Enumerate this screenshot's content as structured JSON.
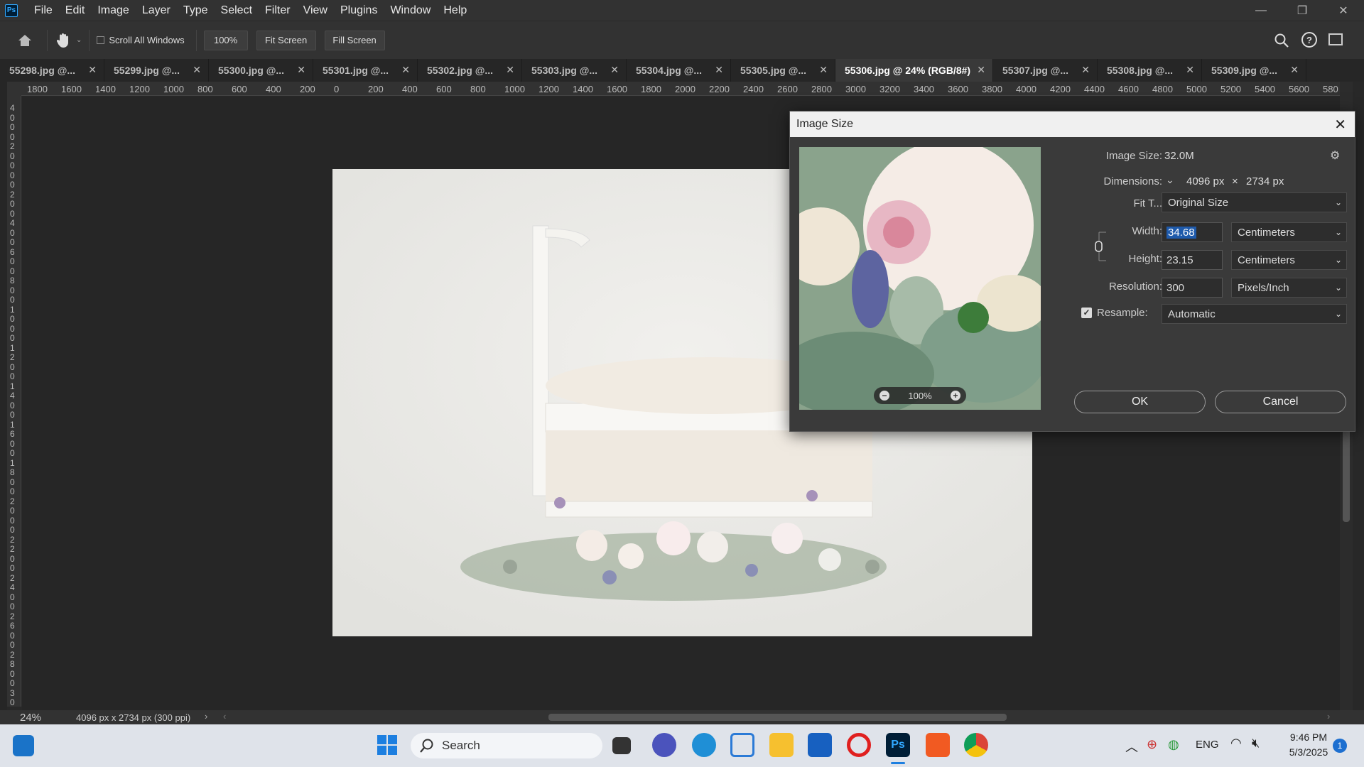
{
  "app": {
    "logo": "Ps"
  },
  "menu": [
    "File",
    "Edit",
    "Image",
    "Layer",
    "Type",
    "Select",
    "Filter",
    "View",
    "Plugins",
    "Window",
    "Help"
  ],
  "options": {
    "scroll_all_windows": "Scroll All Windows",
    "zoom": "100%",
    "fit_screen": "Fit Screen",
    "fill_screen": "Fill Screen"
  },
  "tabs": [
    {
      "label": "55298.jpg @..."
    },
    {
      "label": "55299.jpg @..."
    },
    {
      "label": "55300.jpg @..."
    },
    {
      "label": "55301.jpg @..."
    },
    {
      "label": "55302.jpg @..."
    },
    {
      "label": "55303.jpg @..."
    },
    {
      "label": "55304.jpg @..."
    },
    {
      "label": "55305.jpg @..."
    },
    {
      "label": "55306.jpg @ 24% (RGB/8#)"
    },
    {
      "label": "55307.jpg @..."
    },
    {
      "label": "55308.jpg @..."
    },
    {
      "label": "55309.jpg @..."
    }
  ],
  "ruler_h": [
    "1800",
    "1600",
    "1400",
    "1200",
    "1000",
    "800",
    "600",
    "400",
    "200",
    "0",
    "200",
    "400",
    "600",
    "800",
    "1000",
    "1200",
    "1400",
    "1600",
    "1800",
    "2000",
    "2200",
    "2400",
    "2600",
    "2800",
    "3000",
    "3200",
    "3400",
    "3600",
    "3800",
    "4000",
    "4200",
    "4400",
    "4600",
    "4800",
    "5000",
    "5200",
    "5400",
    "5600",
    "580"
  ],
  "ruler_v": [
    "4",
    "0",
    "0",
    "0",
    "2",
    "0",
    "0",
    "0",
    "0",
    "2",
    "0",
    "0",
    "4",
    "0",
    "0",
    "6",
    "0",
    "0",
    "8",
    "0",
    "0",
    "1",
    "0",
    "0",
    "0",
    "1",
    "2",
    "0",
    "0",
    "1",
    "4",
    "0",
    "0",
    "1",
    "6",
    "0",
    "0",
    "1",
    "8",
    "0",
    "0",
    "2",
    "0",
    "0",
    "0",
    "2",
    "2",
    "0",
    "0",
    "2",
    "4",
    "0",
    "0",
    "2",
    "6",
    "0",
    "0",
    "2",
    "8",
    "0",
    "0",
    "3",
    "0"
  ],
  "status": {
    "zoom": "24%",
    "doc_info": "4096 px x 2734 px (300 ppi)"
  },
  "dialog": {
    "title": "Image Size",
    "image_size_label": "Image Size:",
    "image_size": "32.0M",
    "dimensions_label": "Dimensions:",
    "dim_w": "4096 px",
    "dim_x": "×",
    "dim_h": "2734 px",
    "fit_label": "Fit T...",
    "fit_value": "Original Size",
    "width_label": "Width:",
    "width_value": "34.68",
    "width_unit": "Centimeters",
    "height_label": "Height:",
    "height_value": "23.15",
    "height_unit": "Centimeters",
    "resolution_label": "Resolution:",
    "resolution_value": "300",
    "resolution_unit": "Pixels/Inch",
    "resample_label": "Resample:",
    "resample_value": "Automatic",
    "resample_checked": true,
    "preview_zoom": "100%",
    "ok": "OK",
    "cancel": "Cancel"
  },
  "taskbar": {
    "search": "Search",
    "language": "ENG",
    "time": "9:46 PM",
    "date": "5/3/2025",
    "notifications": "1"
  }
}
